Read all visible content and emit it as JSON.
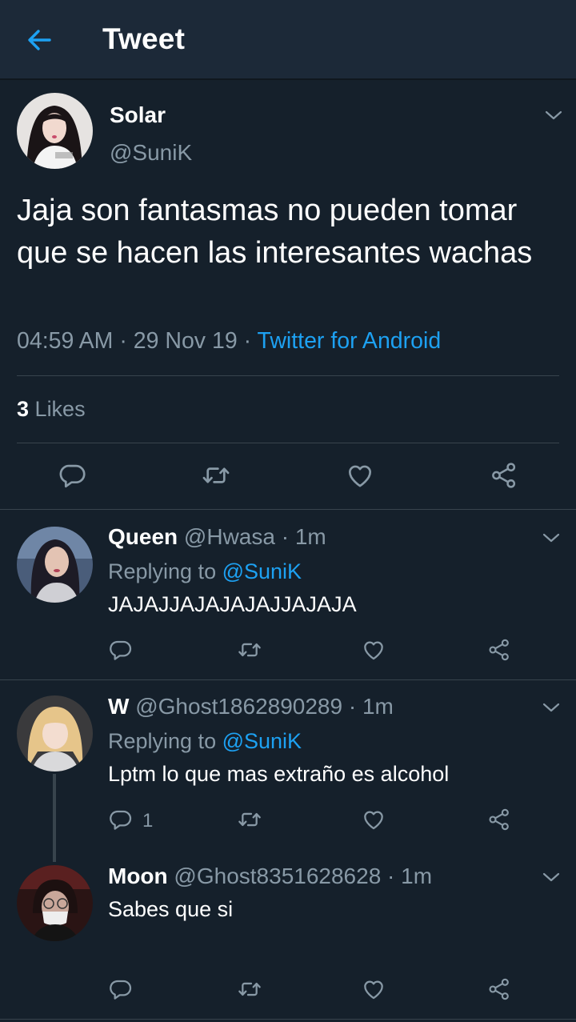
{
  "header": {
    "title": "Tweet",
    "back_icon": "arrow-left-icon"
  },
  "colors": {
    "background": "#15202b",
    "header_bg": "#1c2938",
    "accent": "#1da1f2",
    "muted": "#8899a6",
    "divider": "#38444d"
  },
  "main_tweet": {
    "name": "Solar",
    "handle": "@SuniK",
    "text": "Jaja son fantasmas no pueden tomar que se hacen las interesantes wachas",
    "time": "04:59 AM",
    "sep1": " · ",
    "date": "29 Nov 19",
    "sep2": " · ",
    "source": "Twitter for Android",
    "likes_count": "3",
    "likes_label": "Likes"
  },
  "replies": [
    {
      "name": "Queen",
      "handle": "@Hwasa",
      "dot": " · ",
      "time": "1m",
      "replying_prefix": "Replying to ",
      "replying_to": "@SuniK",
      "text": "JAJAJJAJAJAJAJJAJAJA",
      "reply_count": ""
    },
    {
      "name": "W",
      "handle": "@Ghost1862890289",
      "dot": " · ",
      "time": "1m",
      "replying_prefix": "Replying to ",
      "replying_to": "@SuniK",
      "text": "Lptm lo que mas extraño es alcohol",
      "reply_count": "1"
    },
    {
      "name": "Moon",
      "handle": "@Ghost8351628628",
      "dot": " · ",
      "time": "1m",
      "text": "Sabes que si",
      "reply_count": ""
    }
  ],
  "icons": [
    "reply-icon",
    "retweet-icon",
    "like-icon",
    "share-icon",
    "chevron-down-icon"
  ]
}
